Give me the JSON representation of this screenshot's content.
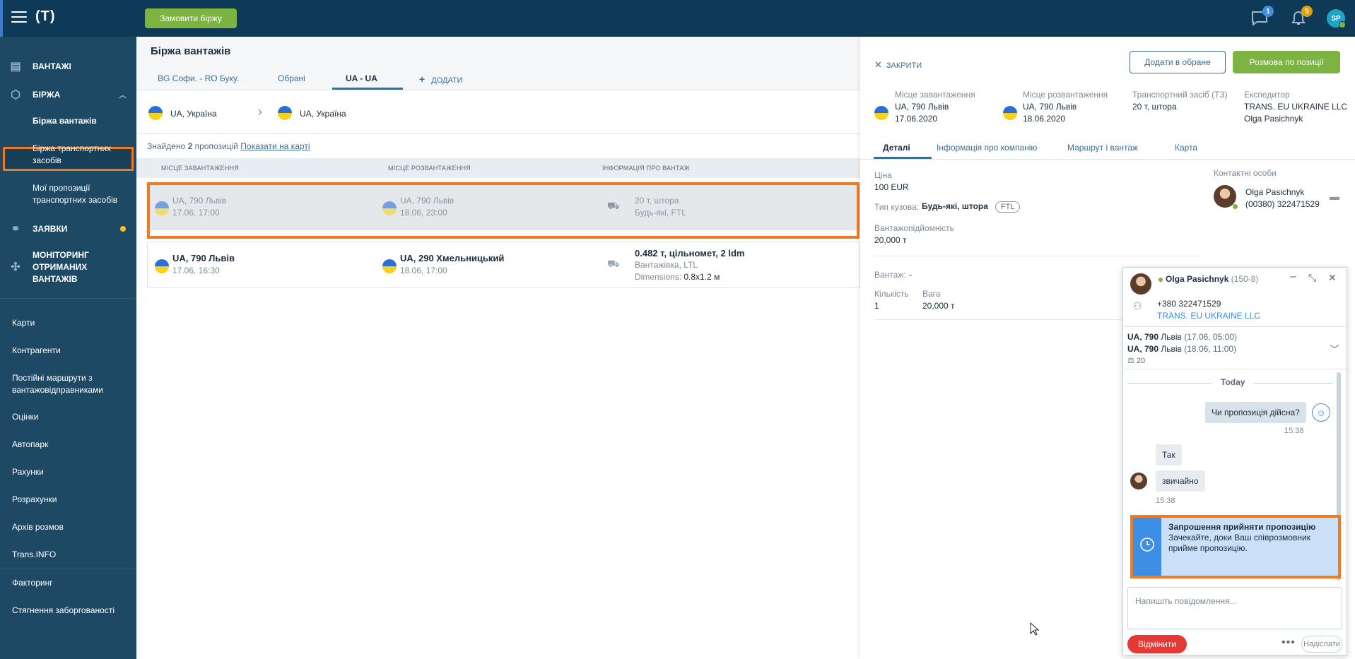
{
  "topbar": {
    "logo": "(T)",
    "order_button": "Замовити біржу",
    "messages_count": "1",
    "notifications_count": "5",
    "user_initials": "SP"
  },
  "sidebar": {
    "main": [
      {
        "label": "ВАНТАЖІ",
        "icon": "cargo-icon"
      },
      {
        "label": "БІРЖА",
        "icon": "box-icon"
      },
      {
        "label": "ЗАЯВКИ",
        "icon": "link-icon"
      },
      {
        "label": "МОНІТОРИНГ ОТРИМАНИХ ВАНТАЖІВ",
        "icon": "satellite-icon"
      }
    ],
    "sub": [
      "Біржа вантажів",
      "Біржа транспортних засобів",
      "Мої пропозиції транспортних засобів"
    ],
    "links": [
      "Карти",
      "Контрагенти",
      "Постійні маршрути з вантажовідправниками",
      "Оцінки",
      "Автопарк",
      "Рахунки",
      "Розрахунки",
      "Архів розмов",
      "Trans.INFO",
      "Факторинг",
      "Стягнення заборгованості"
    ]
  },
  "main": {
    "title": "Біржа вантажів",
    "tabs": [
      "BG Софи. - RO Буку.",
      "Обрані",
      "UA - UA",
      "ДОДАТИ"
    ],
    "route_from": "UA, Україна",
    "route_to": "UA, Україна",
    "found_prefix": "Знайдено",
    "found_count": "2",
    "found_suffix": "пропозицій",
    "show_on_map": "Показати на карті",
    "columns": [
      "МІСЦЕ ЗАВАНТАЖЕННЯ",
      "МІСЦЕ РОЗВАНТАЖЕННЯ",
      "ІНФОРМАЦІЯ ПРО ВАНТАЖ"
    ],
    "rows": [
      {
        "load": "UA, 790 Львів",
        "load_time": "17.06, 17:00",
        "unload": "UA, 790 Львів",
        "unload_time": "18.06, 23:00",
        "info1": "20 т, штора",
        "info2": "Будь-які, FTL"
      },
      {
        "load": "UA, 790 Львів",
        "load_time": "17.06, 16:30",
        "unload": "UA, 290 Хмельницький",
        "unload_time": "18.06, 17:00",
        "info1": "0.482 т, цільномет, 2 ldm",
        "info2": "Вантажівка, LTL",
        "dim_label": "Dimensions:",
        "dim_value": "0.8x1.2 м"
      }
    ]
  },
  "detail": {
    "close": "ЗАКРИТИ",
    "add_fav": "Додати в обране",
    "negotiate": "Розмова по позиції",
    "load_label": "Місце завантаження",
    "load_place": "UA, 790 Львів",
    "load_date": "17.06.2020",
    "unload_label": "Місце розвантаження",
    "unload_place": "UA, 790 Львів",
    "unload_date": "18.06.2020",
    "vehicle_label": "Транспортний засіб (ТЗ)",
    "vehicle": "20 т, штора",
    "forwarder_label": "Експедитор",
    "forwarder_company": "TRANS. EU UKRAINE LLC",
    "forwarder_person": "Olga Pasichnyk",
    "tabs": [
      "Деталі",
      "Інформація про компанію",
      "Маршрут і вантаж",
      "Карта"
    ],
    "price_label": "Ціна",
    "price": "100 EUR",
    "body_label": "Тип кузова:",
    "body_value": "Будь-які, штора",
    "ftl": "FTL",
    "capacity_label": "Вантажопідйомність",
    "capacity": "20,000 т",
    "cargo_label": "Вантаж:",
    "cargo_value": "-",
    "qty_label": "Кількість",
    "qty": "1",
    "weight_label": "Вага",
    "weight": "20,000 т",
    "contacts_label": "Контактні особи",
    "contact_name": "Olga Pasichnyk",
    "contact_phone": "(00380) 322471529"
  },
  "chat": {
    "name": "Olga Pasichnyk",
    "id": "(150-8)",
    "phone": "+380 322471529",
    "company": "TRANS. EU UKRAINE LLC",
    "route1_bold": "UA, 790",
    "route1_city": "Львів",
    "route1_time": "(17.06, 05:00)",
    "route2_bold": "UA, 790",
    "route2_city": "Львів",
    "route2_time": "(18.06, 11:00)",
    "weight": "20",
    "today": "Today",
    "msg1": "Чи пропозиція дійсна?",
    "msg1_time": "15:38",
    "msg2": "Так",
    "msg3": "звичайно",
    "msg3_time": "15:38",
    "invite_title": "Запрошення прийняти пропозицію",
    "invite_text": "Зачекайте, доки Ваш співрозмовник прийме пропозицію.",
    "input_placeholder": "Напишіть повідомлення...",
    "decline": "Відмінити",
    "send": "Надіслати"
  }
}
